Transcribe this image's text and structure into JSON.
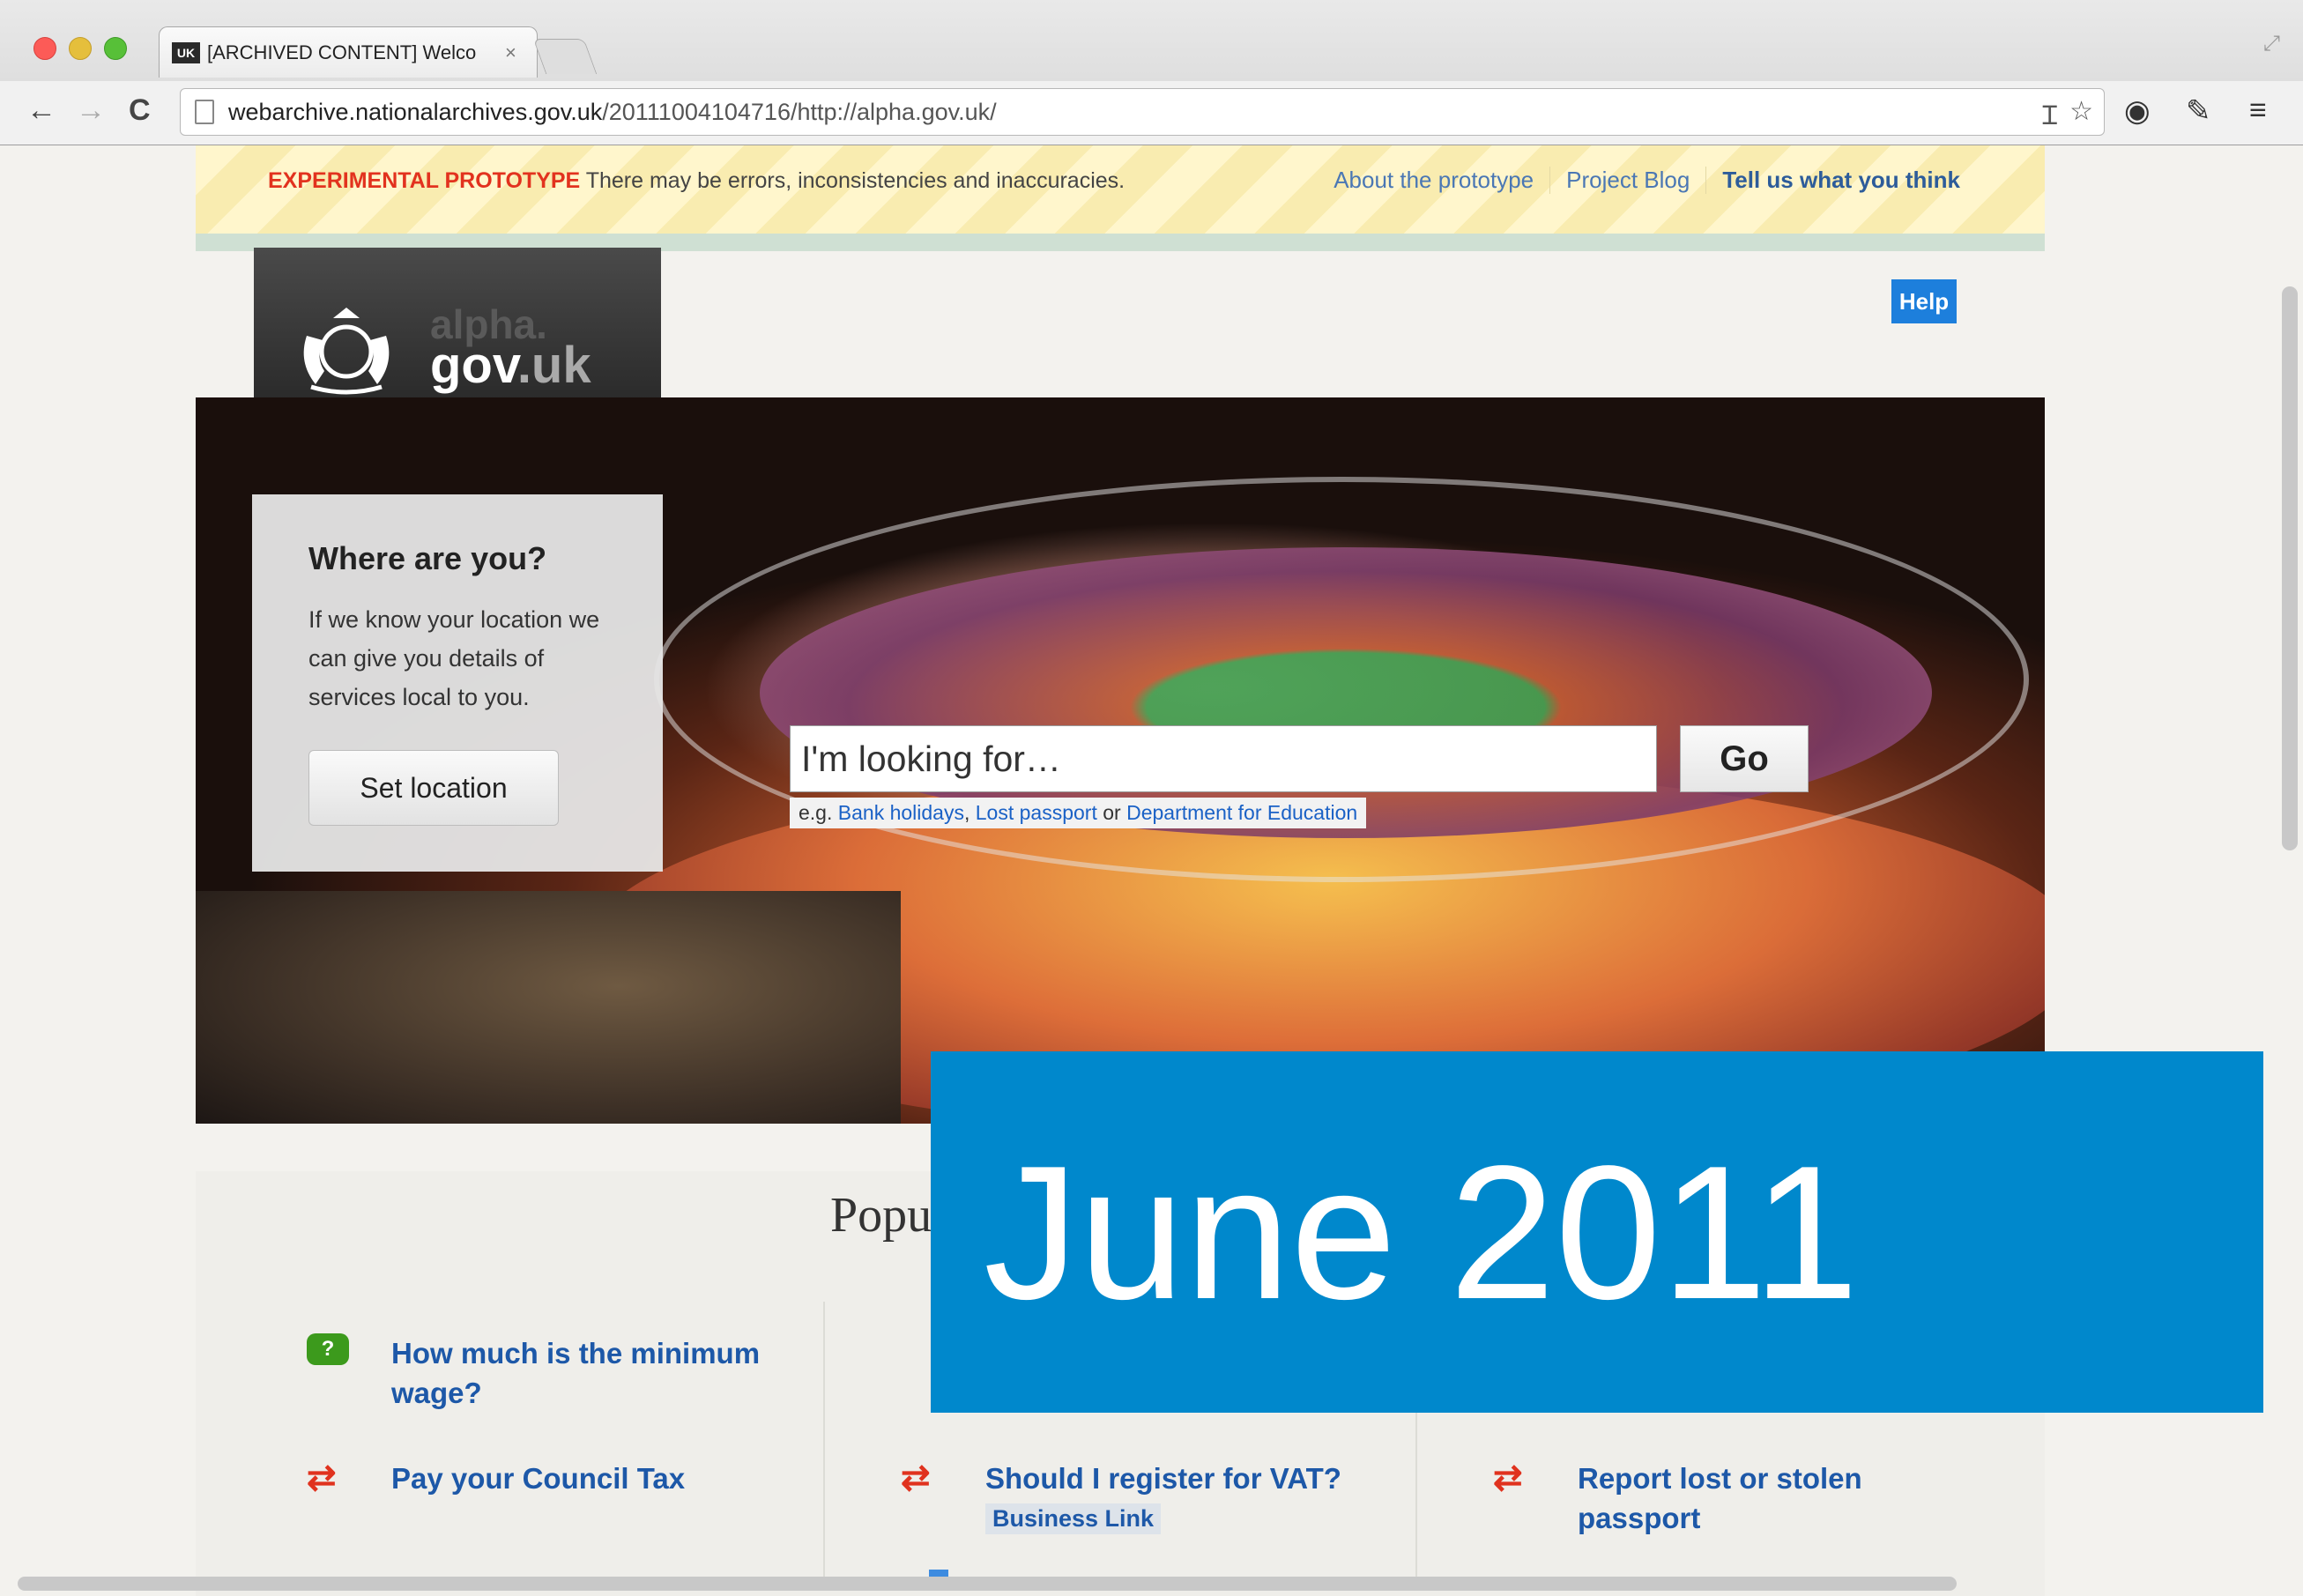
{
  "browser": {
    "tab_title": "[ARCHIVED CONTENT] Welco",
    "tab_favicon": "UK",
    "tab_close": "×",
    "url_host": "webarchive.nationalarchives.gov.uk",
    "url_path": "/20111004104716/http://alpha.gov.uk/",
    "icons": [
      "back-arrow-icon",
      "forward-arrow-icon",
      "reload-icon",
      "page-icon",
      "reader-icon",
      "star-icon",
      "extension-icon",
      "wrench-icon",
      "menu-icon"
    ]
  },
  "banner": {
    "strong": "EXPERIMENTAL PROTOTYPE",
    "text": " There may be errors, inconsistencies and inaccuracies.",
    "links": [
      "About the prototype",
      "Project Blog",
      "Tell us what you think"
    ]
  },
  "logo": {
    "alpha": "alpha.",
    "gov": "gov",
    "uk": ".uk"
  },
  "help_label": "Help",
  "location": {
    "title": "Where are you?",
    "description": "If we know your location we can give you details of services local to you.",
    "button": "Set location"
  },
  "search": {
    "placeholder": "I'm looking for…",
    "go": "Go",
    "eg_prefix": "e.g. ",
    "eg_link1": "Bank holidays",
    "eg_sep1": ", ",
    "eg_link2": "Lost passport",
    "eg_sep2": " or ",
    "eg_link3": "Department for Education"
  },
  "popular": {
    "title": "Popu",
    "items": [
      {
        "label": "How much is the minimum wage?",
        "icon": "speech-bubble-icon"
      },
      {
        "label": "Pay your Council Tax",
        "icon": "transaction-arrows-icon"
      },
      {
        "label": "Should I register for VAT?",
        "tag": "Business Link",
        "icon": "transaction-arrows-icon"
      },
      {
        "label": "Report lost or stolen passport",
        "icon": "transaction-arrows-icon"
      }
    ]
  },
  "overlay": {
    "text": "June 2011"
  },
  "colors": {
    "overlay_blue": "#0088cc",
    "link_blue": "#1d58a8",
    "warning_red": "#e2321e",
    "help_blue": "#1d7fdc"
  }
}
